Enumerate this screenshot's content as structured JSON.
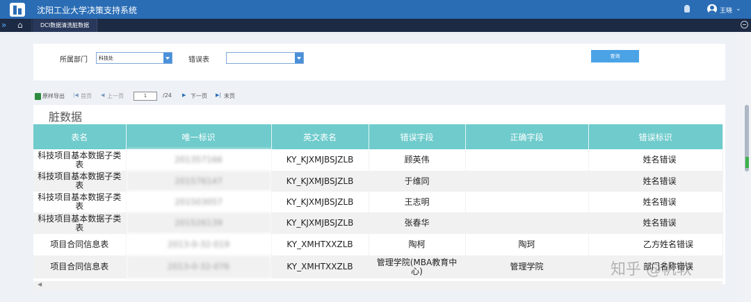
{
  "header": {
    "app_title": "沈阳工业大学决策支持系统",
    "user_name": "王晓",
    "logo_icon": "app-logo-icon",
    "bell_icon": "bell-icon",
    "user_icon": "user-icon"
  },
  "tabbar": {
    "tabs": [
      {
        "label": "DCI数据清洗脏数据",
        "active": true
      }
    ]
  },
  "filter": {
    "department_label": "所属部门",
    "department_value": "科技处",
    "error_table_label": "错误表",
    "error_table_value": "",
    "query_label": "查询"
  },
  "pager": {
    "export_label": "原样导出",
    "first_label": "首页",
    "prev_label": "上一页",
    "page_value": "1",
    "total_label": "/24",
    "next_label": "下一页",
    "last_label": "末页"
  },
  "section": {
    "title": "脏数据"
  },
  "table": {
    "columns": [
      "表名",
      "唯一标识",
      "英文表名",
      "错误字段",
      "正确字段",
      "错误标识"
    ],
    "rows": [
      {
        "table_name": "科技项目基本数据子类表",
        "unique_id": "201357166",
        "en_name": "KY_KJXMJBSJZLB",
        "error_field": "顾英伟",
        "correct_field": "",
        "error_flag": "姓名错误"
      },
      {
        "table_name": "科技项目基本数据子类表",
        "unique_id": "201576147",
        "en_name": "KY_KJXMJBSJZLB",
        "error_field": "于维同",
        "correct_field": "",
        "error_flag": "姓名错误"
      },
      {
        "table_name": "科技项目基本数据子类表",
        "unique_id": "201503057",
        "en_name": "KY_KJXMJBSJZLB",
        "error_field": "王志明",
        "correct_field": "",
        "error_flag": "姓名错误"
      },
      {
        "table_name": "科技项目基本数据子类表",
        "unique_id": "201526139",
        "en_name": "KY_KJXMJBSJZLB",
        "error_field": "张春华",
        "correct_field": "",
        "error_flag": "姓名错误"
      },
      {
        "table_name": "项目合同信息表",
        "unique_id": "2013-0-32-019",
        "en_name": "KY_XMHTXXZLB",
        "error_field": "陶柯",
        "correct_field": "陶珂",
        "error_flag": "乙方姓名错误"
      },
      {
        "table_name": "项目合同信息表",
        "unique_id": "2013-0-32-076",
        "en_name": "KY_XMHTXXZLB",
        "error_field": "管理学院(MBA教育中心)",
        "correct_field": "管理学院",
        "error_flag": "部门名称错误"
      }
    ]
  },
  "watermark": "知乎 @帆软",
  "colors": {
    "header_bg": "#2a6db5",
    "tabbar_bg": "#1d2a44",
    "table_header_bg": "#6fcbcc",
    "query_button": "#4ba3e6"
  }
}
